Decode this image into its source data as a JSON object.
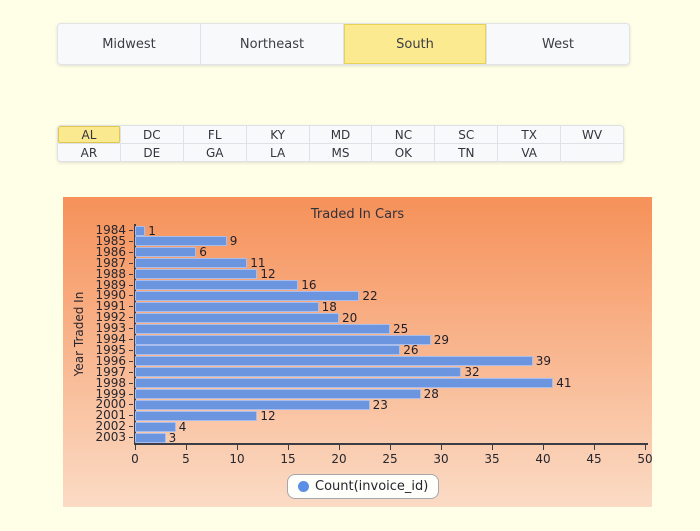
{
  "tabs": {
    "items": [
      "Midwest",
      "Northeast",
      "South",
      "West"
    ],
    "selected": "South"
  },
  "states": {
    "rows": [
      [
        "AL",
        "DC",
        "FL",
        "KY",
        "MD",
        "NC",
        "SC",
        "TX",
        "WV"
      ],
      [
        "AR",
        "DE",
        "GA",
        "LA",
        "MS",
        "OK",
        "TN",
        "VA",
        ""
      ]
    ],
    "selected": "AL"
  },
  "chart_data": {
    "type": "bar",
    "orientation": "horizontal",
    "title": "Traded In Cars",
    "ylabel": "Year Traded In",
    "xlabel": "",
    "categories": [
      "1984",
      "1985",
      "1986",
      "1987",
      "1988",
      "1989",
      "1990",
      "1991",
      "1992",
      "1993",
      "1994",
      "1995",
      "1996",
      "1997",
      "1998",
      "1999",
      "2000",
      "2001",
      "2002",
      "2003"
    ],
    "values": [
      1,
      9,
      6,
      11,
      12,
      16,
      22,
      18,
      20,
      25,
      29,
      26,
      39,
      32,
      41,
      28,
      23,
      12,
      4,
      3
    ],
    "xticks": [
      0,
      5,
      10,
      15,
      20,
      25,
      30,
      35,
      40,
      45,
      50
    ],
    "xlim": [
      0,
      50
    ],
    "grid": false,
    "legend": "Count(invoice_id)",
    "legend_position": "bottom-center",
    "bar_color": "#6B95DE",
    "bar_border_color": "#A9BEEC",
    "background_gradient_top": "#F69159",
    "background_gradient_bottom": "#FBDBC5"
  },
  "colors": {
    "page_background": "#FFFFE8",
    "selected_highlight": "#FBEA90",
    "selected_border": "#E8D252",
    "panel_background": "#F8F9FB"
  }
}
